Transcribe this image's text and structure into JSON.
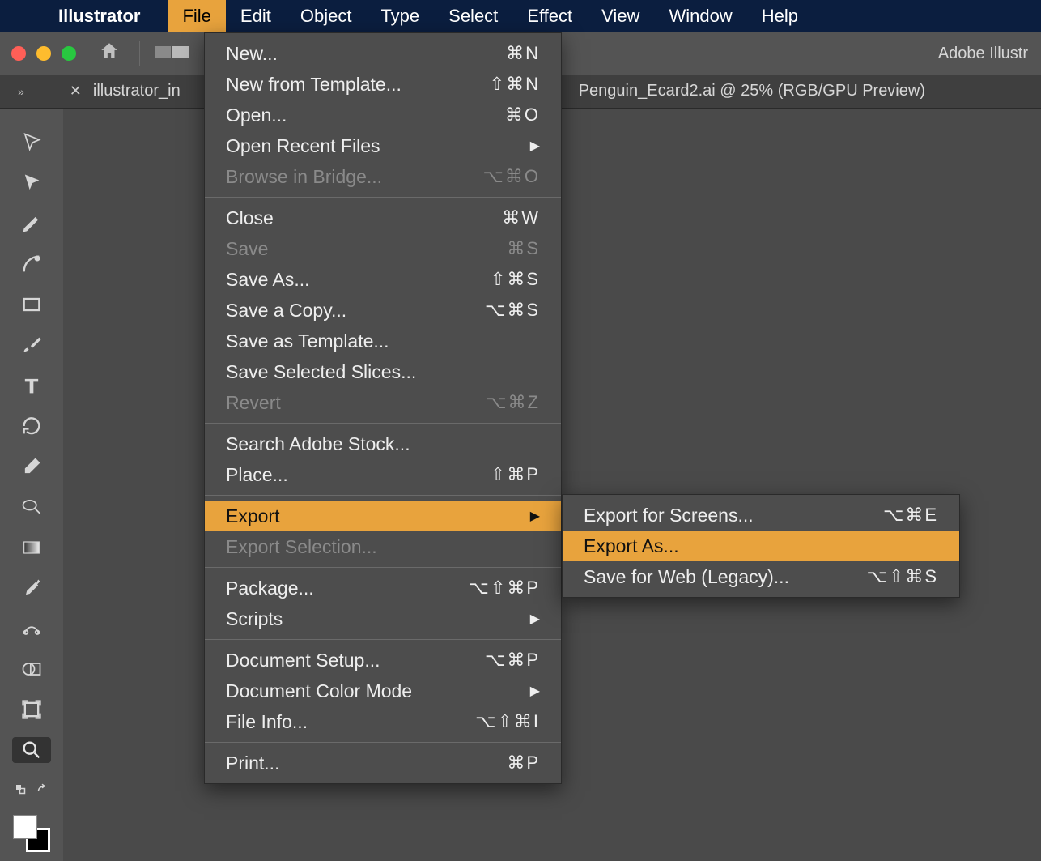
{
  "menubar": {
    "app_name": "Illustrator",
    "items": [
      "File",
      "Edit",
      "Object",
      "Type",
      "Select",
      "Effect",
      "View",
      "Window",
      "Help"
    ],
    "active": "File"
  },
  "app_chrome": {
    "title_right": "Adobe Illustr"
  },
  "tabs": {
    "tab1": "illustrator_in",
    "tab2": "Penguin_Ecard2.ai @ 25% (RGB/GPU Preview)"
  },
  "file_menu": {
    "groups": [
      [
        {
          "label": "New...",
          "shortcut": "⌘N"
        },
        {
          "label": "New from Template...",
          "shortcut": "⇧⌘N"
        },
        {
          "label": "Open...",
          "shortcut": "⌘O"
        },
        {
          "label": "Open Recent Files",
          "submenu": true
        },
        {
          "label": "Browse in Bridge...",
          "shortcut": "⌥⌘O",
          "disabled": true
        }
      ],
      [
        {
          "label": "Close",
          "shortcut": "⌘W"
        },
        {
          "label": "Save",
          "shortcut": "⌘S",
          "disabled": true
        },
        {
          "label": "Save As...",
          "shortcut": "⇧⌘S"
        },
        {
          "label": "Save a Copy...",
          "shortcut": "⌥⌘S"
        },
        {
          "label": "Save as Template..."
        },
        {
          "label": "Save Selected Slices..."
        },
        {
          "label": "Revert",
          "shortcut": "⌥⌘Z",
          "disabled": true
        }
      ],
      [
        {
          "label": "Search Adobe Stock..."
        },
        {
          "label": "Place...",
          "shortcut": "⇧⌘P"
        }
      ],
      [
        {
          "label": "Export",
          "submenu": true,
          "highlight": true
        },
        {
          "label": "Export Selection...",
          "disabled": true
        }
      ],
      [
        {
          "label": "Package...",
          "shortcut": "⌥⇧⌘P"
        },
        {
          "label": "Scripts",
          "submenu": true
        }
      ],
      [
        {
          "label": "Document Setup...",
          "shortcut": "⌥⌘P"
        },
        {
          "label": "Document Color Mode",
          "submenu": true
        },
        {
          "label": "File Info...",
          "shortcut": "⌥⇧⌘I"
        }
      ],
      [
        {
          "label": "Print...",
          "shortcut": "⌘P"
        }
      ]
    ]
  },
  "export_submenu": [
    {
      "label": "Export for Screens...",
      "shortcut": "⌥⌘E"
    },
    {
      "label": "Export As...",
      "highlight": true
    },
    {
      "label": "Save for Web (Legacy)...",
      "shortcut": "⌥⇧⌘S"
    }
  ],
  "tools": [
    "selection",
    "direct-selection",
    "pen",
    "curvature",
    "rectangle",
    "paintbrush",
    "type",
    "rotate",
    "eraser",
    "shaper",
    "gradient",
    "eyedropper",
    "blend",
    "shape-builder",
    "artboard",
    "zoom"
  ]
}
